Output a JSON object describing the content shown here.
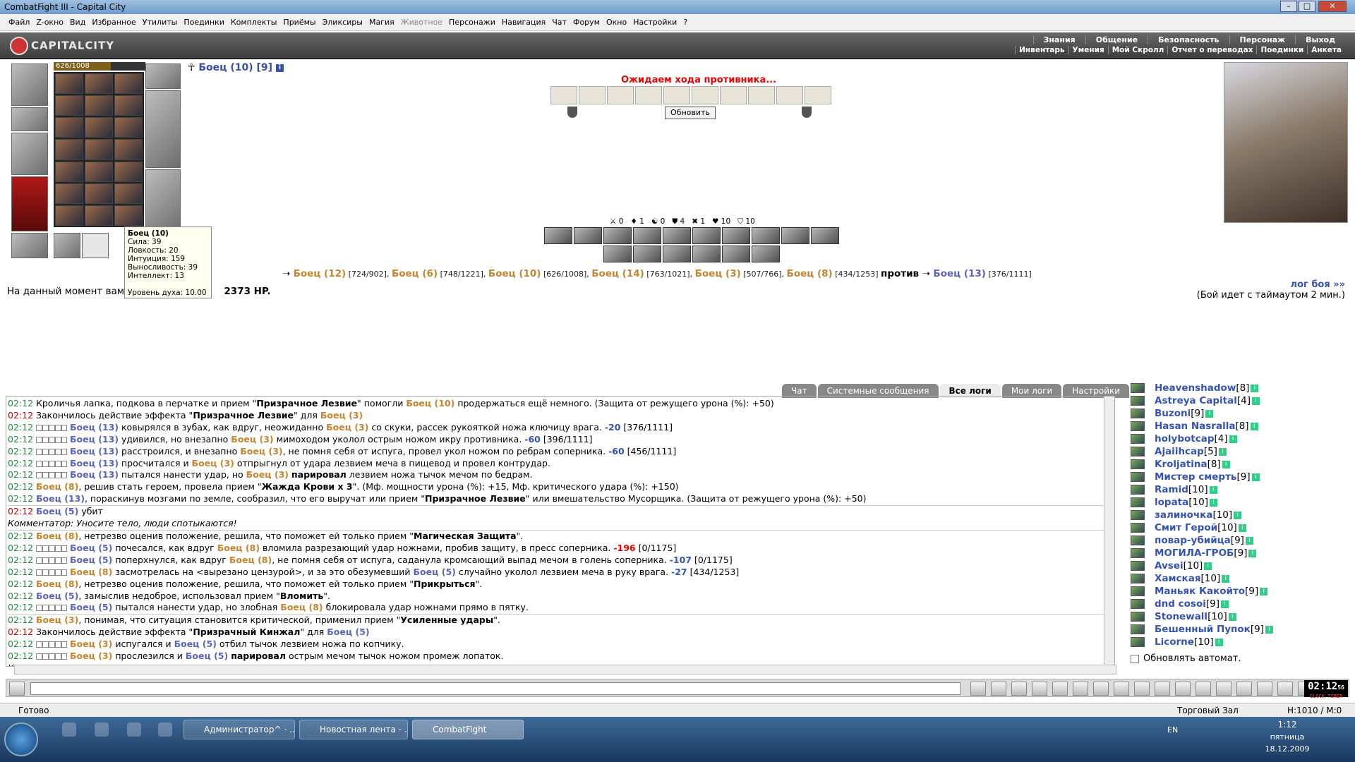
{
  "window": {
    "title": "CombatFight III - Capital City"
  },
  "menu": [
    "Файл",
    "Z-окно",
    "Вид",
    "Избранное",
    "Утилиты",
    "Поединки",
    "Комплекты",
    "Приёмы",
    "Эликсиры",
    "Магия",
    "Животное",
    "Персонажи",
    "Навигация",
    "Чат",
    "Форум",
    "Окно",
    "Настройки",
    "?"
  ],
  "header": {
    "logo": "CAPITALCITY",
    "nav_top": [
      "Знания",
      "Общение",
      "Безопасность",
      "Персонаж",
      "Выход"
    ],
    "nav_bottom": [
      "Инвентарь",
      "Умения",
      "Мой Скролл",
      "Отчет о переводах",
      "Поединки",
      "Анкета"
    ]
  },
  "character": {
    "hp": "626/1008",
    "hp_fraction": 0.62,
    "name": "Боец (10) [9]"
  },
  "tooltip": {
    "title": "Боец (10)",
    "lines": [
      "Сила: 39",
      "Ловкость: 20",
      "Интуиция: 159",
      "Выносливость: 39",
      "Интеллект: 13"
    ],
    "spirit": "Уровень духа: 10.00"
  },
  "battle": {
    "waiting": "Ожидаем хода противника...",
    "refresh": "Обновить",
    "stats": [
      "0",
      "1",
      "0",
      "4",
      "1",
      "10",
      "10"
    ],
    "team1": [
      {
        "n": "Боец (12)",
        "hp": "[724/902]"
      },
      {
        "n": "Боец (6)",
        "hp": "[748/1221]"
      },
      {
        "n": "Боец (10)",
        "hp": "[626/1008]"
      },
      {
        "n": "Боец (14)",
        "hp": "[763/1021]"
      },
      {
        "n": "Боец (3)",
        "hp": "[507/766]"
      },
      {
        "n": "Боец (8)",
        "hp": "[434/1253]"
      }
    ],
    "vs": "против",
    "team2": [
      {
        "n": "Боец (13)",
        "hp": "[376/1111]"
      }
    ],
    "damage_pre": "На данный момент вами",
    "damage_val": "2373 HP.",
    "log_link": "лог боя »»",
    "timeout": "(Бой идет с таймаутом 2 мин.)"
  },
  "tabs": [
    "Чат",
    "Системные сообщения",
    "Все логи",
    "Мои логи",
    "Настройки"
  ],
  "log": [
    {
      "t": "02:12",
      "c": "t",
      "h": "Кроличья лапка, подкова в перчатке и прием \"<b>Призрачное Лезвие</b>\" помогли <span class='f'>Боец (10)</span> продержаться ещё немного. (Защита от режущего урона (%): +50)"
    },
    {
      "t": "02:12",
      "c": "tr",
      "h": "Закончилось действие эффекта \"<b>Призрачное Лезвие</b>\" для <span class='f'>Боец (3)</span>"
    },
    {
      "t": "02:12",
      "c": "t",
      "h": "<span class='blk'></span><span class='e'>Боец (13)</span> ковырялся в зубах, как вдруг, неожиданно <span class='f'>Боец (3)</span> со скуки, рассек рукояткой ножа ключицу врага. <span class='d'>-20</span> [376/1111]"
    },
    {
      "t": "02:12",
      "c": "t",
      "h": "<span class='blk'></span><span class='e'>Боец (13)</span> удивился, но внезапно <span class='f'>Боец (3)</span> мимоходом уколол острым ножом икру противника. <span class='d'>-60</span> [396/1111]"
    },
    {
      "t": "02:12",
      "c": "t",
      "h": "<span class='blk'></span><span class='e'>Боец (13)</span> расстроился, и внезапно <span class='f'>Боец (3)</span>, не помня себя от испуга, провел укол ножом по ребрам соперника. <span class='d'>-60</span> [456/1111]"
    },
    {
      "t": "02:12",
      "c": "t",
      "h": "<span class='blk'></span><span class='e'>Боец (13)</span> просчитался и <span class='f'>Боец (3)</span> отпрыгнул от удара лезвием меча в пищевод и провел контрудар."
    },
    {
      "t": "02:12",
      "c": "t",
      "h": "<span class='blk'></span><span class='e'>Боец (13)</span> пытался нанести удар, но <span class='f'>Боец (3)</span> <b>парировал</b> лезвием ножа тычок мечом по бедрам."
    },
    {
      "t": "02:12",
      "c": "t",
      "h": "<span class='f'>Боец (8)</span>, решив стать героем, провела прием \"<b>Жажда Крови x 3</b>\". (Мф. мощности урона (%): +15, Мф. критического удара (%): +150)"
    },
    {
      "t": "02:12",
      "c": "t",
      "h": "<span class='e'>Боец (13)</span>, пораскинув мозгами по земле, сообразил, что его выручат или прием \"<b>Призрачное Лезвие</b>\" или вмешательство Мусорщика. (Защита от режущего урона (%): +50)",
      "sep": true
    },
    {
      "t": "02:12",
      "c": "tr",
      "h": "<span class='e'>Боец (5)</span> убит"
    },
    {
      "t": "",
      "c": "t",
      "h": "<i>Комментатор: Уносите тело, люди спотыкаются!</i>",
      "sep": true
    },
    {
      "t": "02:12",
      "c": "t",
      "h": "<span class='f'>Боец (8)</span>, нетрезво оценив положение, решила, что поможет ей только прием \"<b>Магическая Защита</b>\"."
    },
    {
      "t": "02:12",
      "c": "t",
      "h": "<span class='blk'></span><span class='e'>Боец (5)</span> почесался, как вдруг <span class='f'>Боец (8)</span> вломила разрезающий удар ножнами, пробив защиту, в пресс соперника. <span class='bd'>-196</span> [0/1175]"
    },
    {
      "t": "02:12",
      "c": "t",
      "h": "<span class='blk'></span><span class='e'>Боец (5)</span> поперхнулся, как вдруг <span class='f'>Боец (8)</span>, не помня себя от испуга, саданула кромсающий выпад мечом в голень соперника. <span class='d'>-107</span> [0/1175]"
    },
    {
      "t": "02:12",
      "c": "t",
      "h": "<span class='blk'></span><span class='f'>Боец (8)</span> засмотрелась на &lt;вырезано цензурой&gt;, и за это обезумевший <span class='e'>Боец (5)</span> случайно уколол лезвием меча в руку врага. <span class='d'>-27</span> [434/1253]"
    },
    {
      "t": "02:12",
      "c": "t",
      "h": "<span class='f'>Боец (8)</span>, нетрезво оценив положение, решила, что поможет ей только прием \"<b>Прикрыться</b>\"."
    },
    {
      "t": "02:12",
      "c": "t",
      "h": "<span class='e'>Боец (5)</span>, замыслив недоброе, использовал прием \"<b>Вломить</b>\"."
    },
    {
      "t": "02:12",
      "c": "t",
      "h": "<span class='blk'></span><span class='e'>Боец (5)</span> пытался нанести удар, но злобная <span class='f'>Боец (8)</span> блокировала удар ножнами прямо в пятку.",
      "sep": true
    },
    {
      "t": "02:12",
      "c": "t",
      "h": "<span class='f'>Боец (3)</span>, понимая, что ситуация становится критической, применил прием \"<b>Усиленные удары</b>\"."
    },
    {
      "t": "02:12",
      "c": "tr",
      "h": "Закончилось действие эффекта \"<b>Призрачный Кинжал</b>\" для <span class='e'>Боец (5)</span>"
    },
    {
      "t": "02:12",
      "c": "t",
      "h": "<span class='blk'></span><span class='f'>Боец (3)</span> испугался и <span class='e'>Боец (5)</span> отбил тычок лезвием ножа по копчику."
    },
    {
      "t": "02:12",
      "c": "t",
      "h": "<span class='blk'></span><span class='f'>Боец (3)</span> прослезился и <span class='e'>Боец (5)</span> <b>парировал</b> острым мечом тычок ножом промеж лопаток."
    },
    {
      "t": "",
      "c": "t",
      "h": "<i>Комментатор: Ничего... Блок тоже удар.</i>"
    }
  ],
  "users": [
    {
      "n": "Heavenshadow",
      "l": "[8]"
    },
    {
      "n": "Astreya Capital",
      "l": "[4]"
    },
    {
      "n": "Buzoni",
      "l": "[9]"
    },
    {
      "n": "Hasan Nasralla",
      "l": "[8]"
    },
    {
      "n": "holybotcap",
      "l": "[4]"
    },
    {
      "n": "Ajaiihcap",
      "l": "[5]"
    },
    {
      "n": "Kroljatina",
      "l": "[8]"
    },
    {
      "n": "Мистер смерть",
      "l": "[9]"
    },
    {
      "n": "Ramid",
      "l": "[10]"
    },
    {
      "n": "lopata",
      "l": "[10]"
    },
    {
      "n": "залиночка",
      "l": "[10]"
    },
    {
      "n": "Смит Герой",
      "l": "[10]"
    },
    {
      "n": "повар-убийца",
      "l": "[9]"
    },
    {
      "n": "МОГИЛА-ГРОБ",
      "l": "[9]"
    },
    {
      "n": "Avsei",
      "l": "[10]"
    },
    {
      "n": "Хамская",
      "l": "[10]"
    },
    {
      "n": "Маньяк Какойто",
      "l": "[9]"
    },
    {
      "n": "dnd cosoi",
      "l": "[9]"
    },
    {
      "n": "Stonewall",
      "l": "[10]"
    },
    {
      "n": "Бешенный Пупок",
      "l": "[9]"
    },
    {
      "n": "Licorne",
      "l": "[10]"
    }
  ],
  "autorefresh": "Обновлять автомат.",
  "clock": {
    "time": "02:12",
    "sec": "56",
    "label": "CLOCK TIMER"
  },
  "status": {
    "ready": "Готово",
    "hall": "Торговый Зал",
    "hm": "H:1010 / M:0"
  },
  "taskbar": {
    "tasks": [
      "Администратор^ - ...",
      "Новостная лента - ...",
      "CombatFight"
    ],
    "lang": "EN",
    "time": "1:12",
    "day": "пятница",
    "date": "18.12.2009"
  }
}
